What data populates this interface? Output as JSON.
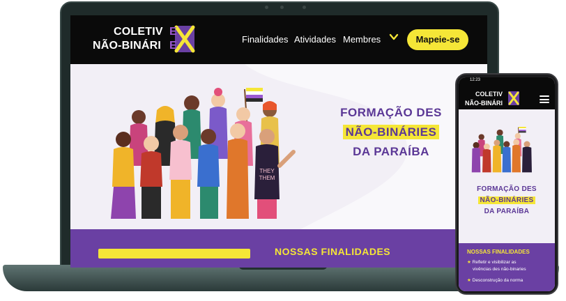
{
  "brand": {
    "logo_line1": "COLETIV",
    "logo_line2": "NÃO-BINÁRI",
    "logo_accent": "E",
    "colors": {
      "dark": "#0a0a0a",
      "purple": "#6a40a3",
      "title_purple": "#5b3796",
      "yellow": "#f5e637"
    }
  },
  "laptop": {
    "nav": {
      "items": [
        {
          "label": "Finalidades"
        },
        {
          "label": "Atividades"
        },
        {
          "label": "Membres"
        }
      ],
      "dropdown_icon": "chevron-down-icon",
      "cta_label": "Mapeie-se"
    },
    "hero": {
      "title_line1": "FORMAÇÃO DES",
      "title_line2": "NÃO-BINÁRIES",
      "title_line3": "DA PARAÍBA",
      "shirt_text_line1": "THEY",
      "shirt_text_line2": "THEM"
    },
    "finalidades": {
      "title": "NOSSAS FINALIDADES"
    }
  },
  "phone": {
    "status_time": "12:23",
    "menu_icon": "hamburger-menu-icon",
    "hero": {
      "title_line1": "FORMAÇÃO DES",
      "title_line2": "NÃO-BINÁRIES",
      "title_line3": "DA PARAÍBA"
    },
    "finalidades": {
      "title": "NOSSAS FINALIDADES",
      "item1_line1": "Refletir e visibilizar as",
      "item1_line2": "vivências des não-binaries",
      "item2": "Desconstrução da norma"
    }
  }
}
